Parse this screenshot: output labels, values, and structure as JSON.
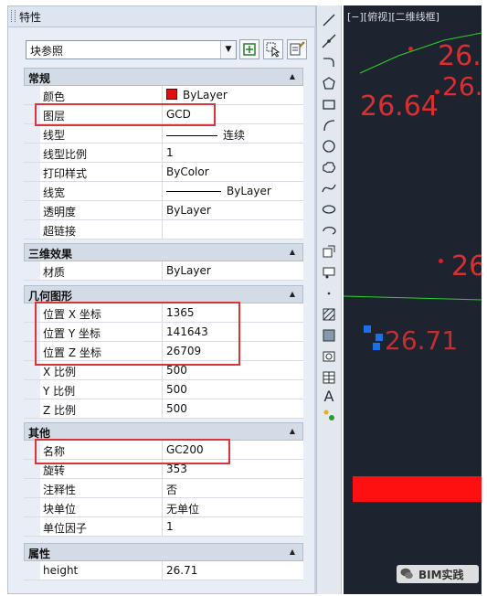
{
  "palette": {
    "title": "特性"
  },
  "dropdown": {
    "value": "块参照"
  },
  "sections": {
    "general": "常规",
    "effects3d": "三维效果",
    "geometry": "几何图形",
    "misc": "其他",
    "attributes": "属性"
  },
  "general": [
    {
      "name": "颜色",
      "value": "ByLayer"
    },
    {
      "name": "图层",
      "value": "GCD"
    },
    {
      "name": "线型",
      "value": "连续"
    },
    {
      "name": "线型比例",
      "value": "1"
    },
    {
      "name": "打印样式",
      "value": "ByColor"
    },
    {
      "name": "线宽",
      "value": "ByLayer"
    },
    {
      "name": "透明度",
      "value": "ByLayer"
    },
    {
      "name": "超链接",
      "value": ""
    }
  ],
  "effects3d": [
    {
      "name": "材质",
      "value": "ByLayer"
    }
  ],
  "geometry": [
    {
      "name": "位置 X 坐标",
      "value": "1365"
    },
    {
      "name": "位置 Y 坐标",
      "value": "141643"
    },
    {
      "name": "位置 Z 坐标",
      "value": "26709"
    },
    {
      "name": "X 比例",
      "value": "500"
    },
    {
      "name": "Y 比例",
      "value": "500"
    },
    {
      "name": "Z 比例",
      "value": "500"
    }
  ],
  "misc": [
    {
      "name": "名称",
      "value": "GC200"
    },
    {
      "name": "旋转",
      "value": "353"
    },
    {
      "name": "注释性",
      "value": "否"
    },
    {
      "name": "块单位",
      "value": "无单位"
    },
    {
      "name": "单位因子",
      "value": "1"
    }
  ],
  "attributes": [
    {
      "name": "height",
      "value": "26.71"
    }
  ],
  "viewport": {
    "label": "[−][俯视][二维线框]",
    "texts": [
      "26.6",
      "26.7",
      "26.64",
      "26",
      "26.71"
    ]
  },
  "watermark": {
    "text": "BIM实践"
  },
  "colors": {
    "highlight": "#d9343a",
    "bylayer_swatch": "#e01010",
    "viewport_bg": "#1e2330",
    "cad_text": "#d83030",
    "cad_line": "#2ad42a",
    "cad_block": "#ff1010",
    "cad_grip": "#1e6ee6"
  }
}
